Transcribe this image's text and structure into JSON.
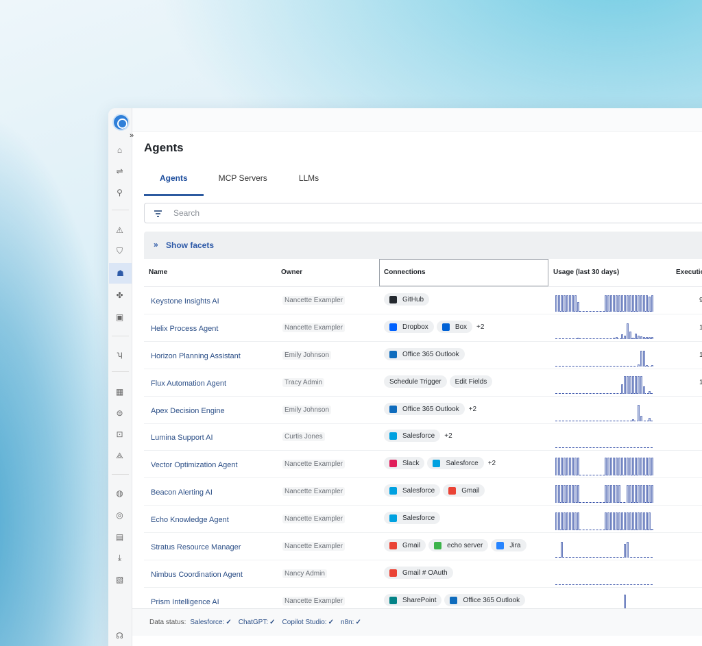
{
  "page": {
    "title": "Agents"
  },
  "tabs": [
    {
      "label": "Agents",
      "active": true
    },
    {
      "label": "MCP Servers",
      "active": false
    },
    {
      "label": "LLMs",
      "active": false
    }
  ],
  "search": {
    "placeholder": "Search"
  },
  "facets": {
    "label": "Show facets"
  },
  "table": {
    "columns": [
      "Name",
      "Owner",
      "Connections",
      "Usage (last 30 days)",
      "Executio"
    ],
    "rows": [
      {
        "name": "Keystone Insights AI",
        "owner": "Nancette Exampler",
        "connections": [
          {
            "label": "GitHub",
            "icon": "github-icon",
            "color": "#24292f"
          }
        ],
        "more": "",
        "exec": "9",
        "usage": [
          0.9,
          0.9,
          0.9,
          0.9,
          0.9,
          0.9,
          0.9,
          0.9,
          0.5,
          0,
          0,
          0,
          0,
          0,
          0,
          0,
          0,
          0,
          0.9,
          0.9,
          0.9,
          0.9,
          0.9,
          0.9,
          0.9,
          0.9,
          0.9,
          0.9,
          0.9,
          0.9,
          0.9,
          0.9,
          0.9,
          0.9,
          0.8,
          0.9
        ]
      },
      {
        "name": "Helix Process Agent",
        "owner": "Nancette Exampler",
        "connections": [
          {
            "label": "Dropbox",
            "icon": "dropbox-icon",
            "color": "#0061fe"
          },
          {
            "label": "Box",
            "icon": "box-icon",
            "color": "#0061d5"
          }
        ],
        "more": "+2",
        "exec": "1",
        "usage": [
          0,
          0,
          0,
          0,
          0,
          0,
          0,
          0,
          0.08,
          0,
          0,
          0,
          0,
          0,
          0,
          0,
          0,
          0,
          0,
          0,
          0,
          0.08,
          0.1,
          0,
          0.25,
          0.2,
          0.85,
          0.4,
          0.05,
          0.3,
          0.2,
          0.15,
          0.1,
          0.1,
          0.1,
          0.1
        ]
      },
      {
        "name": "Horizon Planning Assistant",
        "owner": "Emily Johnson",
        "connections": [
          {
            "label": "Office 365 Outlook",
            "icon": "outlook-icon",
            "color": "#0f6cbd"
          }
        ],
        "more": "",
        "exec": "1",
        "usage": [
          0,
          0,
          0,
          0,
          0,
          0,
          0,
          0,
          0,
          0,
          0,
          0,
          0,
          0,
          0,
          0,
          0,
          0,
          0,
          0,
          0,
          0,
          0,
          0,
          0,
          0,
          0,
          0,
          0,
          0,
          0.1,
          0.85,
          0.85,
          0.05,
          0,
          0.08
        ]
      },
      {
        "name": "Flux Automation Agent",
        "owner": "Tracy Admin",
        "connections": [
          {
            "label": "Schedule Trigger",
            "icon": "",
            "color": ""
          },
          {
            "label": "Edit Fields",
            "icon": "",
            "color": ""
          }
        ],
        "more": "",
        "exec": "1",
        "usage": [
          0,
          0,
          0,
          0,
          0,
          0,
          0,
          0,
          0,
          0,
          0,
          0,
          0,
          0,
          0,
          0,
          0,
          0,
          0,
          0,
          0,
          0,
          0,
          0,
          0.5,
          0.95,
          0.95,
          0.95,
          0.95,
          0.95,
          0.95,
          0.95,
          0.4,
          0,
          0.15,
          0
        ]
      },
      {
        "name": "Apex Decision Engine",
        "owner": "Emily Johnson",
        "connections": [
          {
            "label": "Office 365 Outlook",
            "icon": "outlook-icon",
            "color": "#0f6cbd"
          }
        ],
        "more": "+2",
        "exec": "",
        "usage": [
          0,
          0,
          0,
          0,
          0,
          0,
          0,
          0,
          0,
          0,
          0,
          0,
          0,
          0,
          0,
          0,
          0,
          0,
          0,
          0,
          0,
          0,
          0,
          0,
          0,
          0,
          0,
          0,
          0.1,
          0,
          0.9,
          0.3,
          0,
          0,
          0.2,
          0
        ]
      },
      {
        "name": "Lumina Support AI",
        "owner": "Curtis Jones",
        "connections": [
          {
            "label": "Salesforce",
            "icon": "salesforce-icon",
            "color": "#00a1e0"
          }
        ],
        "more": "+2",
        "exec": "",
        "usage": [
          0,
          0,
          0,
          0,
          0,
          0,
          0,
          0,
          0,
          0,
          0,
          0,
          0,
          0,
          0,
          0,
          0,
          0,
          0,
          0,
          0,
          0,
          0,
          0,
          0,
          0,
          0,
          0,
          0,
          0,
          0,
          0,
          0,
          0,
          0,
          0
        ]
      },
      {
        "name": "Vector Optimization Agent",
        "owner": "Nancette Exampler",
        "connections": [
          {
            "label": "Slack",
            "icon": "slack-icon",
            "color": "#e01e5a"
          },
          {
            "label": "Salesforce",
            "icon": "salesforce-icon",
            "color": "#00a1e0"
          }
        ],
        "more": "+2",
        "exec": "",
        "usage": [
          0.95,
          0.95,
          0.95,
          0.95,
          0.95,
          0.95,
          0.95,
          0.95,
          0.95,
          0,
          0,
          0,
          0,
          0,
          0,
          0,
          0,
          0,
          0.95,
          0.95,
          0.95,
          0.95,
          0.95,
          0.95,
          0.95,
          0.95,
          0.95,
          0.95,
          0.95,
          0.95,
          0.95,
          0.95,
          0.95,
          0.95,
          0.95,
          0.95
        ]
      },
      {
        "name": "Beacon Alerting AI",
        "owner": "Nancette Exampler",
        "connections": [
          {
            "label": "Salesforce",
            "icon": "salesforce-icon",
            "color": "#00a1e0"
          },
          {
            "label": "Gmail",
            "icon": "gmail-icon",
            "color": "#ea4335"
          }
        ],
        "more": "",
        "exec": "",
        "usage": [
          0.95,
          0.95,
          0.95,
          0.95,
          0.95,
          0.95,
          0.95,
          0.95,
          0.95,
          0,
          0,
          0,
          0,
          0,
          0,
          0,
          0,
          0,
          0.95,
          0.95,
          0.95,
          0.95,
          0.95,
          0.95,
          0,
          0,
          0.95,
          0.95,
          0.95,
          0.95,
          0.95,
          0.95,
          0.95,
          0.95,
          0.95,
          0.95
        ]
      },
      {
        "name": "Echo Knowledge Agent",
        "owner": "Nancette Exampler",
        "connections": [
          {
            "label": "Salesforce",
            "icon": "salesforce-icon",
            "color": "#00a1e0"
          }
        ],
        "more": "",
        "exec": "",
        "usage": [
          0.95,
          0.95,
          0.95,
          0.95,
          0.95,
          0.95,
          0.95,
          0.95,
          0.95,
          0,
          0,
          0,
          0,
          0,
          0,
          0,
          0,
          0,
          0.95,
          0.95,
          0.95,
          0.95,
          0.95,
          0.95,
          0.95,
          0.95,
          0.95,
          0.95,
          0.95,
          0.95,
          0.95,
          0.95,
          0.95,
          0.95,
          0.95,
          0.05
        ]
      },
      {
        "name": "Stratus Resource Manager",
        "owner": "Nancette Exampler",
        "connections": [
          {
            "label": "Gmail",
            "icon": "gmail-icon",
            "color": "#ea4335"
          },
          {
            "label": "echo server",
            "icon": "echo-icon",
            "color": "#3bb34a"
          },
          {
            "label": "Jira",
            "icon": "jira-icon",
            "color": "#2684ff"
          }
        ],
        "more": "",
        "exec": "",
        "usage": [
          0,
          0,
          0.85,
          0,
          0,
          0,
          0,
          0,
          0,
          0,
          0,
          0,
          0,
          0,
          0,
          0,
          0,
          0,
          0,
          0,
          0,
          0,
          0,
          0,
          0,
          0.75,
          0.85,
          0,
          0,
          0,
          0,
          0,
          0,
          0,
          0,
          0
        ]
      },
      {
        "name": "Nimbus Coordination Agent",
        "owner": "Nancy Admin",
        "connections": [
          {
            "label": "Gmail # OAuth",
            "icon": "gmail-icon",
            "color": "#ea4335"
          }
        ],
        "more": "",
        "exec": "",
        "usage": [
          0,
          0,
          0,
          0,
          0,
          0,
          0,
          0,
          0,
          0,
          0,
          0,
          0,
          0,
          0,
          0,
          0,
          0,
          0,
          0,
          0,
          0,
          0,
          0,
          0,
          0,
          0,
          0,
          0,
          0,
          0,
          0,
          0,
          0,
          0,
          0
        ]
      },
      {
        "name": "Prism Intelligence AI",
        "owner": "Nancette Exampler",
        "connections": [
          {
            "label": "SharePoint",
            "icon": "sharepoint-icon",
            "color": "#038387"
          },
          {
            "label": "Office 365 Outlook",
            "icon": "outlook-icon",
            "color": "#0f6cbd"
          }
        ],
        "more": "",
        "exec": "",
        "usage": [
          0,
          0,
          0,
          0,
          0,
          0,
          0,
          0,
          0,
          0,
          0,
          0,
          0,
          0,
          0,
          0,
          0,
          0,
          0,
          0,
          0,
          0,
          0,
          0,
          0,
          0.95,
          0,
          0,
          0,
          0,
          0.15,
          0,
          0,
          0,
          0,
          0
        ]
      }
    ]
  },
  "footer": {
    "label": "Data status:",
    "sources": [
      "Salesforce:",
      "ChatGPT:",
      "Copilot Studio:",
      "n8n:"
    ]
  },
  "rail_icons": [
    "home-icon",
    "workflow-icon",
    "search-icon",
    "alert-icon",
    "shield-icon",
    "robot-icon",
    "puzzle-icon",
    "monitor-icon",
    "route-icon",
    "grid-icon",
    "database-icon",
    "dashboard-icon",
    "shapes-icon",
    "globe-icon",
    "target-icon",
    "document-icon",
    "download-icon",
    "report-icon",
    "support-icon"
  ]
}
